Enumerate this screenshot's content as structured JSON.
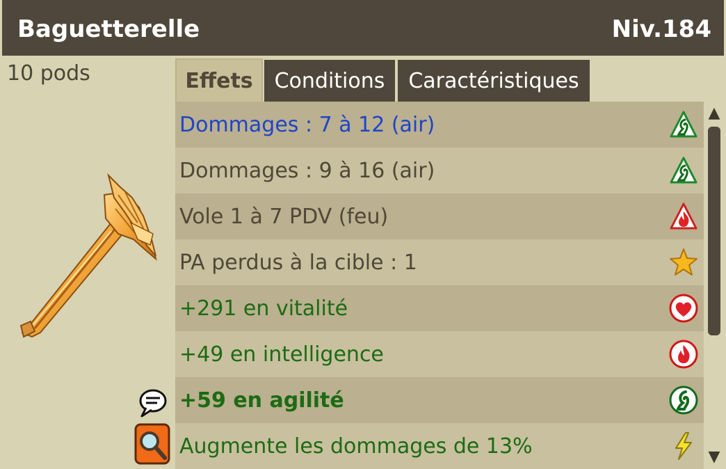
{
  "header": {
    "title": "Baguetterelle",
    "level": "Niv.184"
  },
  "weight": "10 pods",
  "tabs": [
    {
      "label": "Effets",
      "active": true
    },
    {
      "label": "Conditions",
      "active": false
    },
    {
      "label": "Caractéristiques",
      "active": false
    }
  ],
  "effects": [
    {
      "text": "Dommages : 7 à 12 (air)",
      "color": "#1e45c8",
      "icon": "air-triangle-icon"
    },
    {
      "text": "Dommages : 9 à 16 (air)",
      "color": "#4f4838",
      "icon": "air-triangle-icon"
    },
    {
      "text": "Vole 1 à 7 PDV (feu)",
      "color": "#4f4838",
      "icon": "fire-triangle-icon"
    },
    {
      "text": "PA perdus à la cible : 1",
      "color": "#4f4838",
      "icon": "star-icon"
    },
    {
      "text": "+291 en vitalité",
      "color": "#1c6b14",
      "icon": "heart-icon"
    },
    {
      "text": "+49 en intelligence",
      "color": "#1c6b14",
      "icon": "fire-circle-icon"
    },
    {
      "text": "+59 en agilité",
      "color": "#1c6b14",
      "bold": true,
      "icon": "air-circle-icon"
    },
    {
      "text": "Augmente les dommages de 13%",
      "color": "#1c6b14",
      "icon": "lightning-icon"
    }
  ],
  "side_buttons": [
    {
      "icon": "speech-bubble-icon"
    },
    {
      "icon": "magnifier-icon"
    }
  ],
  "scrollbar": {
    "position": 0
  },
  "colors": {
    "header_bg": "#4f473b",
    "panel_bg": "#d8d3b2",
    "row_dark": "#bbb08f",
    "row_light": "#c9c09f"
  }
}
